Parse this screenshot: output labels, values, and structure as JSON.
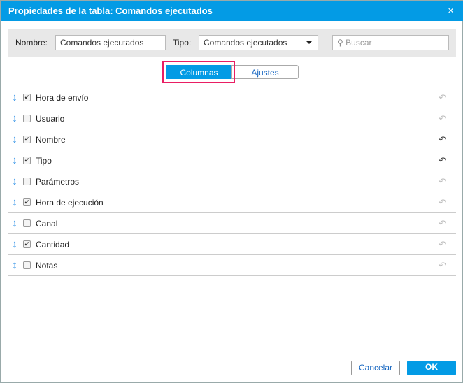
{
  "title": "Propiedades de la tabla: Comandos ejecutados",
  "close_icon": "×",
  "name_label": "Nombre:",
  "name_value": "Comandos ejecutados",
  "type_label": "Tipo:",
  "type_value": "Comandos ejecutados",
  "search_placeholder": "Buscar",
  "tabs": {
    "columns": "Columnas",
    "settings": "Ajustes"
  },
  "rows": [
    {
      "label": "Hora de envío",
      "checked": true,
      "reset_active": false
    },
    {
      "label": "Usuario",
      "checked": false,
      "reset_active": false
    },
    {
      "label": "Nombre",
      "checked": true,
      "reset_active": true
    },
    {
      "label": "Tipo",
      "checked": true,
      "reset_active": true
    },
    {
      "label": "Parámetros",
      "checked": false,
      "reset_active": false
    },
    {
      "label": "Hora de ejecución",
      "checked": true,
      "reset_active": false
    },
    {
      "label": "Canal",
      "checked": false,
      "reset_active": false
    },
    {
      "label": "Cantidad",
      "checked": true,
      "reset_active": false
    },
    {
      "label": "Notas",
      "checked": false,
      "reset_active": false
    }
  ],
  "cancel": "Cancelar",
  "ok": "OK",
  "colors": {
    "accent": "#039be5",
    "highlight": "#e91e63"
  }
}
